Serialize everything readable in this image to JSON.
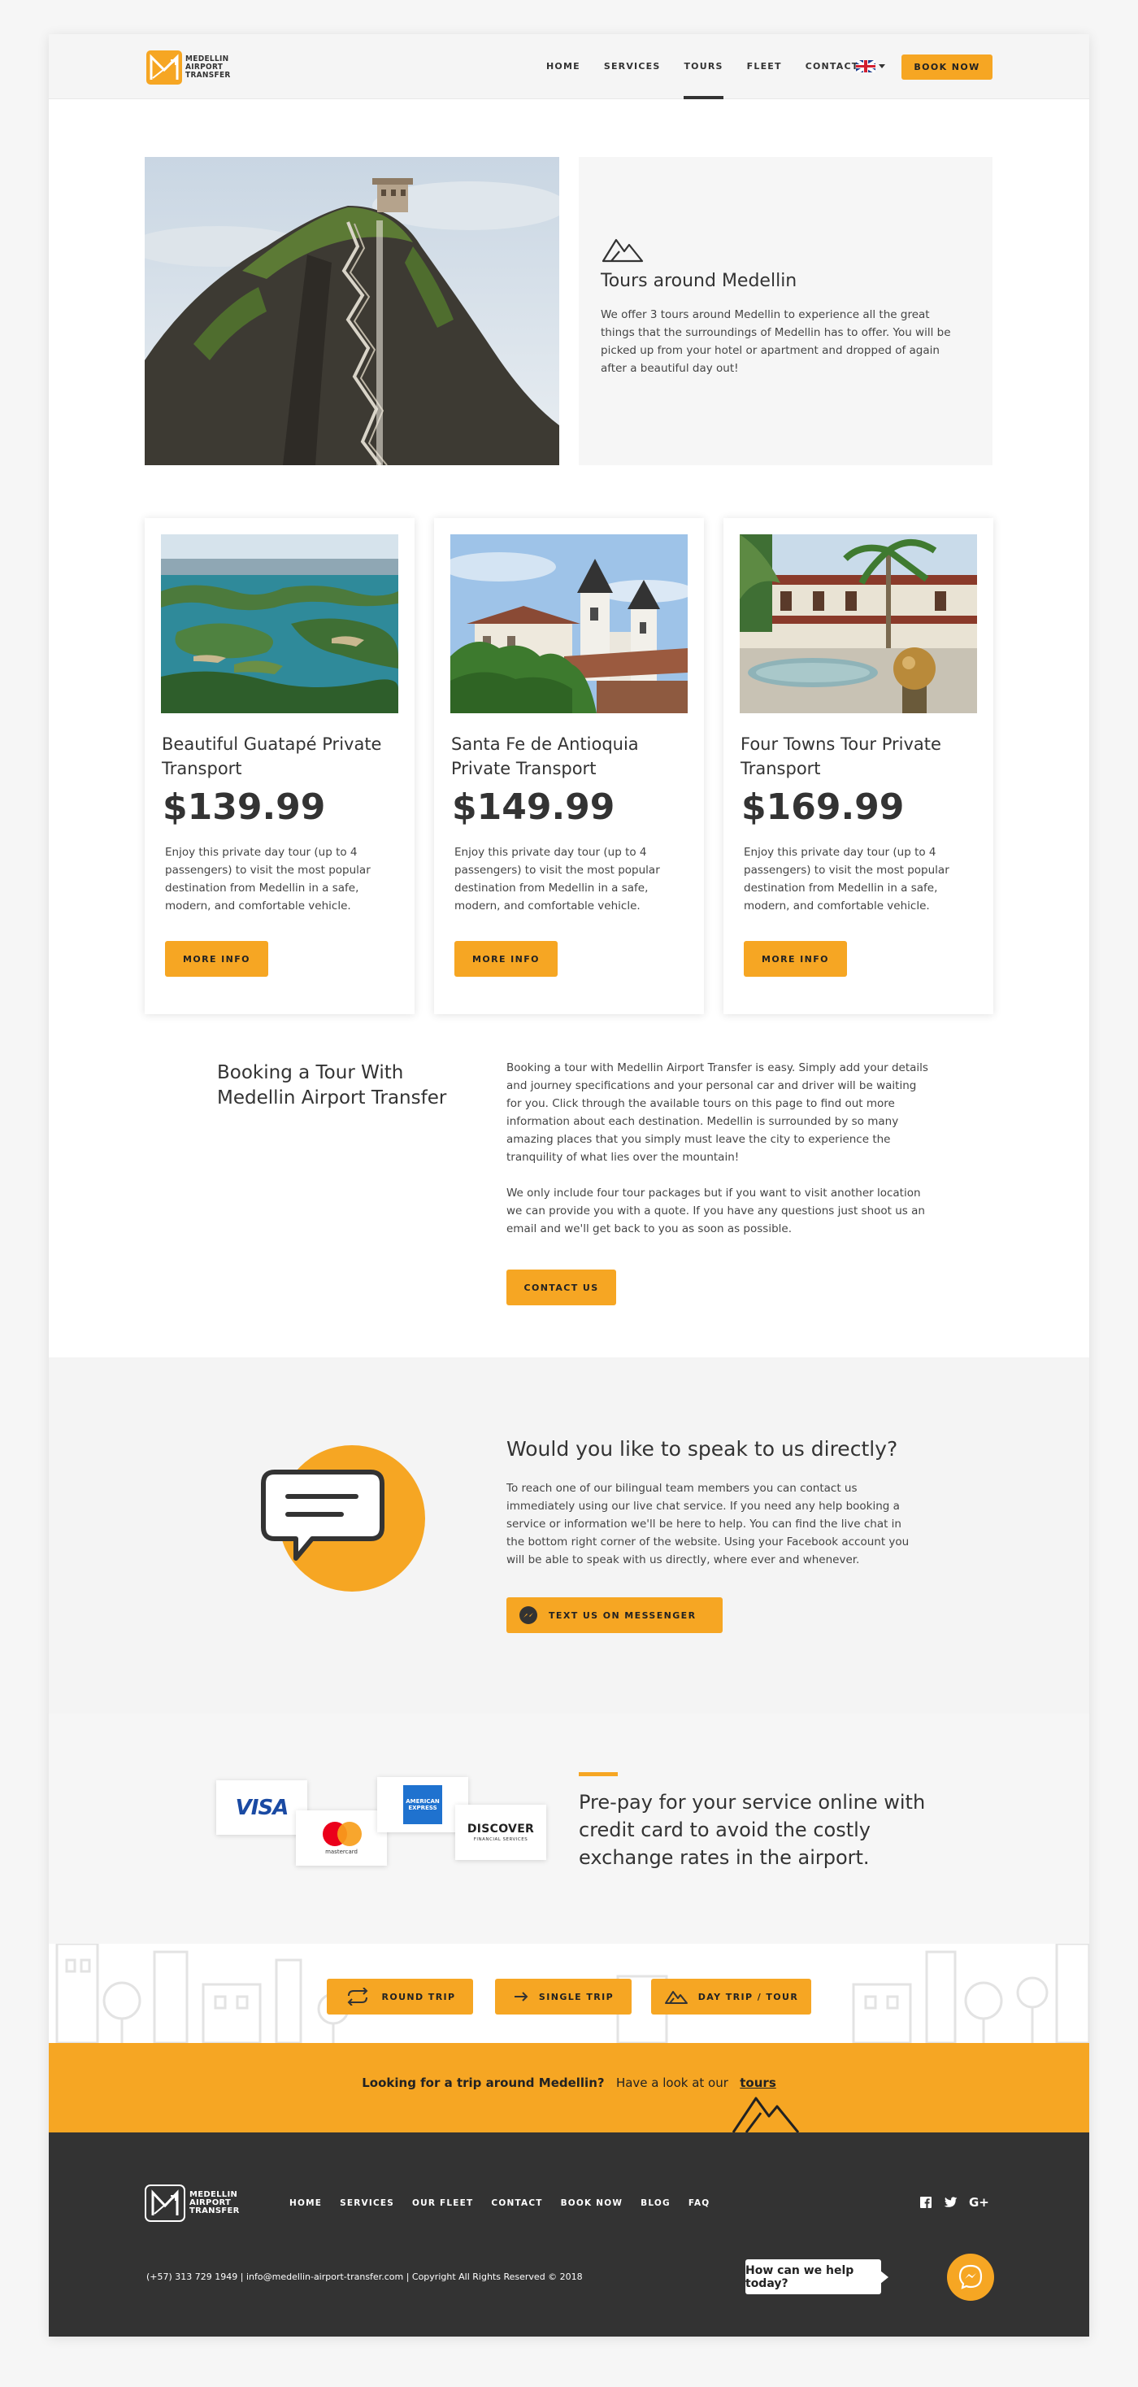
{
  "header": {
    "logo_lines": [
      "MEDELLIN",
      "AIRPORT",
      "TRANSFER"
    ],
    "nav": [
      "HOME",
      "SERVICES",
      "TOURS",
      "FLEET",
      "CONTACT"
    ],
    "active_nav": "TOURS",
    "language_flag": "uk-flag-icon",
    "book_now": "BOOK NOW"
  },
  "intro": {
    "icon": "mountain-icon",
    "title": "Tours around Medellin",
    "text": "We offer 3 tours around Medellin to experience all the great things that the surroundings of Medellin has to offer. You will be picked up from your hotel or apartment and dropped of again after a beautiful day out!"
  },
  "tours": [
    {
      "title": "Beautiful Guatapé Private Transport",
      "price": "$139.99",
      "text": "Enjoy this private day tour (up to 4 passengers) to visit the most popular destination from Medellin in a safe, modern, and comfortable vehicle.",
      "button": "MORE INFO"
    },
    {
      "title": "Santa Fe de Antioquia Private Transport",
      "price": "$149.99",
      "text": "Enjoy this private day tour (up to 4 passengers) to visit the most popular destination from Medellin in a safe, modern, and comfortable vehicle.",
      "button": "MORE INFO"
    },
    {
      "title": "Four Towns Tour Private Transport",
      "price": "$169.99",
      "text": "Enjoy this private day tour (up to 4 passengers) to visit the most popular destination from Medellin in a safe, modern, and comfortable vehicle.",
      "button": "MORE INFO"
    }
  ],
  "booking": {
    "title": "Booking a Tour With Medellin Airport Transfer",
    "paragraph1": "Booking a tour with Medellin Airport Transfer is easy. Simply add your details and journey specifications and your personal car and driver will be waiting for you. Click through the available tours on this page to find out more information about each destination. Medellin is surrounded by so many amazing places that you simply must leave the city to experience the tranquility of what lies over the mountain!",
    "paragraph2": "We only include four tour packages but if you want to visit another location we can provide you with a quote. If you have any questions just shoot us an email and we'll get back to you as soon as possible.",
    "button": "CONTACT US"
  },
  "speak": {
    "title": "Would you like to speak to us directly?",
    "text": "To reach one of our bilingual team members you can contact us immediately using our live chat service. If you need any help booking a service or information we'll be here to help. You can find the live chat in the bottom right corner of the website. Using your Facebook account you will be able to speak with us directly, where ever and whenever.",
    "button": "TEXT US ON MESSENGER"
  },
  "prepay": {
    "cards": {
      "visa": "VISA",
      "mastercard": "mastercard",
      "amex": "AMERICAN EXPRESS",
      "discover": "DISCOVER",
      "discover_sub": "FINANCIAL SERVICES"
    },
    "title": "Pre-pay for your service online with credit card to avoid the costly exchange rates in the airport."
  },
  "trip_buttons": [
    "ROUND TRIP",
    "SINGLE TRIP",
    "DAY TRIP / TOUR"
  ],
  "strip": {
    "lead": "Looking for a trip around Medellin?",
    "middle": "Have a look at our",
    "link": "tours"
  },
  "footer": {
    "logo_lines": [
      "MEDELLIN",
      "AIRPORT",
      "TRANSFER"
    ],
    "nav": [
      "HOME",
      "SERVICES",
      "OUR FLEET",
      "CONTACT",
      "BOOK NOW",
      "BLOG",
      "FAQ"
    ],
    "social": [
      "facebook-icon",
      "twitter-icon",
      "google-plus-icon"
    ],
    "google_plus_label": "G+",
    "contact_line": "(+57) 313 729 1949  |  info@medellin-airport-transfer.com  |  Copyright All Rights Reserved © 2018",
    "chat_prompt": "How can we help today?"
  },
  "colors": {
    "accent": "#f6a623",
    "dark": "#333333",
    "light_bg": "#f6f6f6"
  }
}
